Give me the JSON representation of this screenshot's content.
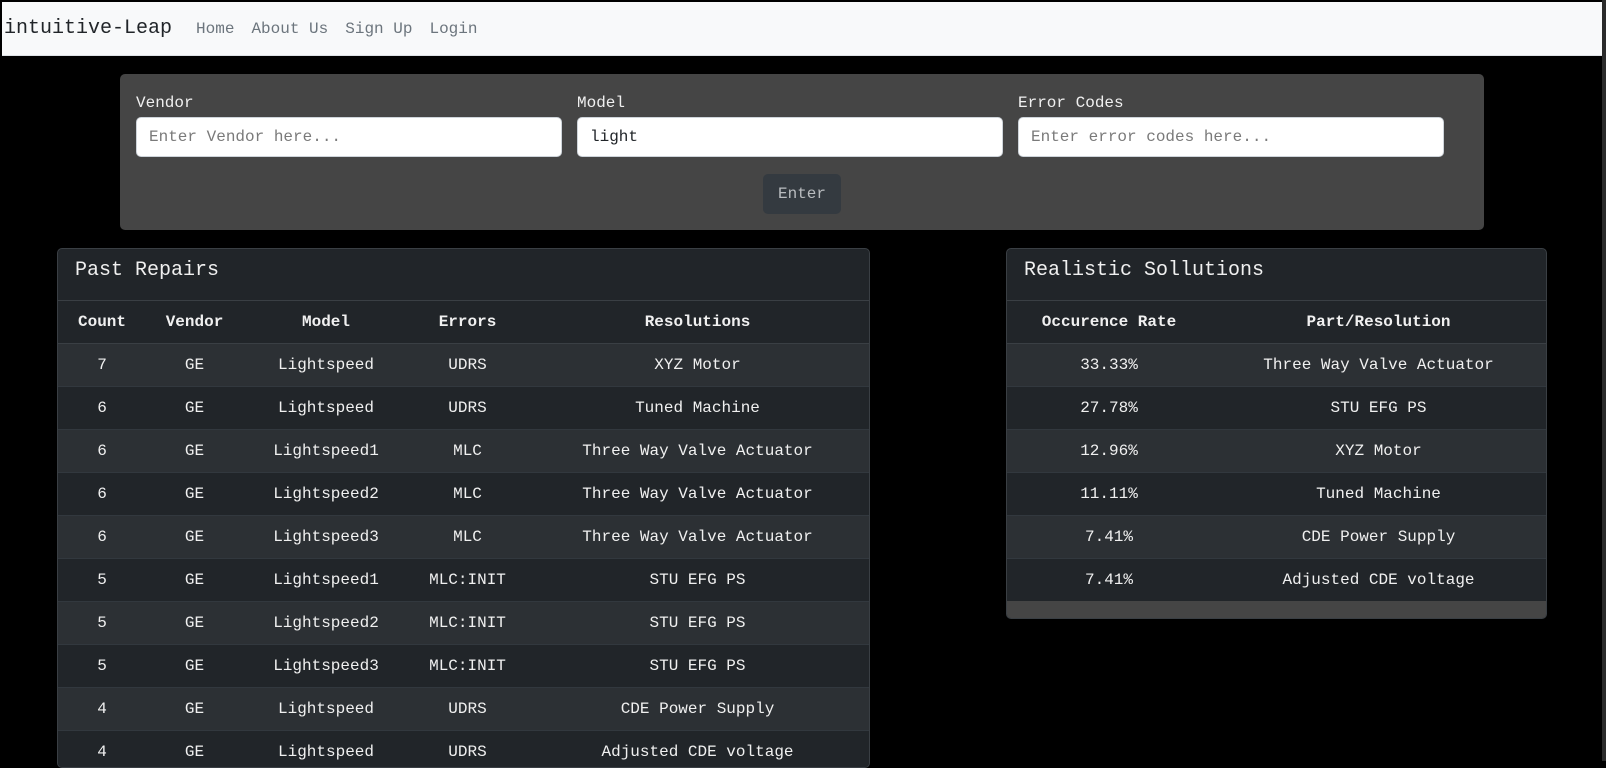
{
  "navbar": {
    "brand": "intuitive-Leap",
    "links": [
      "Home",
      "About Us",
      "Sign Up",
      "Login"
    ]
  },
  "search": {
    "vendor_label": "Vendor",
    "vendor_placeholder": "Enter Vendor here...",
    "vendor_value": "",
    "model_label": "Model",
    "model_placeholder": "",
    "model_value": "light",
    "errors_label": "Error Codes",
    "errors_placeholder": "Enter error codes here...",
    "errors_value": "",
    "enter_label": "Enter"
  },
  "past_repairs": {
    "title": "Past Repairs",
    "columns": [
      "Count",
      "Vendor",
      "Model",
      "Errors",
      "Resolutions"
    ],
    "rows": [
      [
        "7",
        "GE",
        "Lightspeed",
        "UDRS",
        "XYZ Motor"
      ],
      [
        "6",
        "GE",
        "Lightspeed",
        "UDRS",
        "Tuned Machine"
      ],
      [
        "6",
        "GE",
        "Lightspeed1",
        "MLC",
        "Three Way Valve Actuator"
      ],
      [
        "6",
        "GE",
        "Lightspeed2",
        "MLC",
        "Three Way Valve Actuator"
      ],
      [
        "6",
        "GE",
        "Lightspeed3",
        "MLC",
        "Three Way Valve Actuator"
      ],
      [
        "5",
        "GE",
        "Lightspeed1",
        "MLC:INIT",
        "STU EFG PS"
      ],
      [
        "5",
        "GE",
        "Lightspeed2",
        "MLC:INIT",
        "STU EFG PS"
      ],
      [
        "5",
        "GE",
        "Lightspeed3",
        "MLC:INIT",
        "STU EFG PS"
      ],
      [
        "4",
        "GE",
        "Lightspeed",
        "UDRS",
        "CDE Power Supply"
      ],
      [
        "4",
        "GE",
        "Lightspeed",
        "UDRS",
        "Adjusted CDE voltage"
      ]
    ]
  },
  "solutions": {
    "title": "Realistic Sollutions",
    "columns": [
      "Occurence Rate",
      "Part/Resolution"
    ],
    "rows": [
      [
        "33.33%",
        "Three Way Valve Actuator"
      ],
      [
        "27.78%",
        "STU EFG PS"
      ],
      [
        "12.96%",
        "XYZ Motor"
      ],
      [
        "11.11%",
        "Tuned Machine"
      ],
      [
        "7.41%",
        "CDE Power Supply"
      ],
      [
        "7.41%",
        "Adjusted CDE voltage"
      ]
    ]
  }
}
